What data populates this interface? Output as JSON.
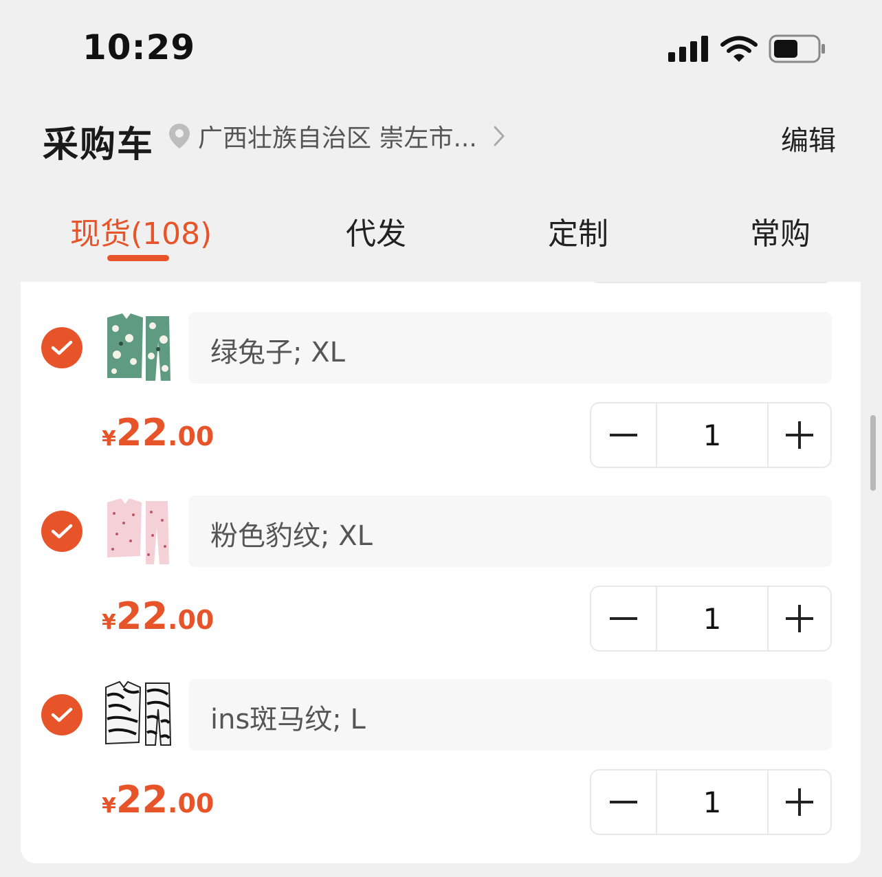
{
  "status_bar": {
    "time": "10:29"
  },
  "header": {
    "title": "采购车",
    "location": "广西壮族自治区 崇左市...",
    "edit_label": "编辑"
  },
  "tabs": [
    {
      "label": "现货(108)",
      "active": true
    },
    {
      "label": "代发",
      "active": false
    },
    {
      "label": "定制",
      "active": false
    },
    {
      "label": "常购",
      "active": false
    }
  ],
  "cart": {
    "items": [
      {
        "spec": "绿兔子; XL",
        "currency": "¥",
        "price_int": "22",
        "price_dec": ".00",
        "quantity": "1",
        "checked": true
      },
      {
        "spec": "粉色豹纹; XL",
        "currency": "¥",
        "price_int": "22",
        "price_dec": ".00",
        "quantity": "1",
        "checked": true
      },
      {
        "spec": "ins斑马纹; L",
        "currency": "¥",
        "price_int": "22",
        "price_dec": ".00",
        "quantity": "1",
        "checked": true
      }
    ]
  },
  "colors": {
    "accent": "#e8542a",
    "background": "#f0f0f0",
    "card": "#ffffff"
  }
}
